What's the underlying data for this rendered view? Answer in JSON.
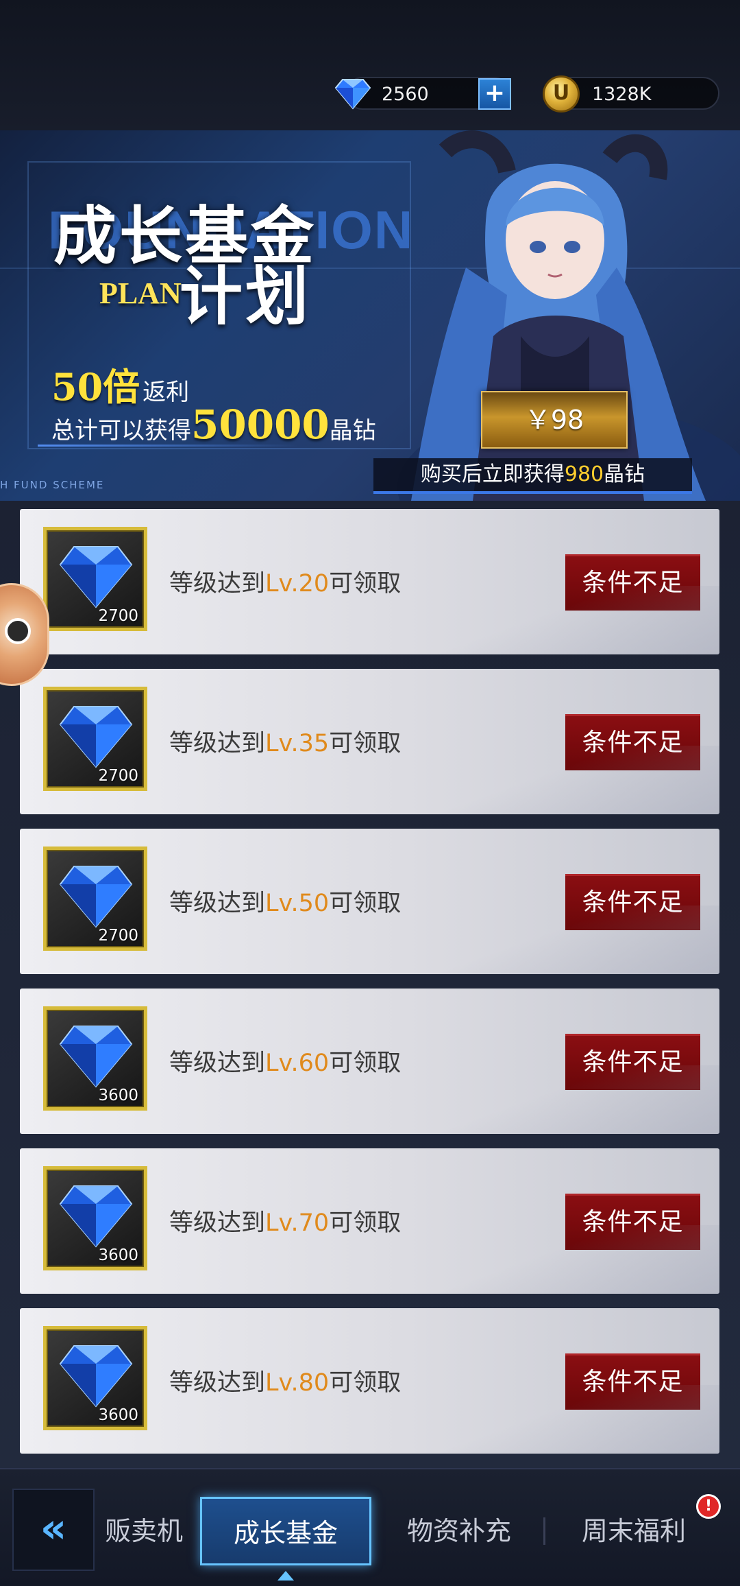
{
  "currency": {
    "diamonds": "2560",
    "coins": "1328K",
    "add_label": "+",
    "coin_symbol": "U"
  },
  "banner": {
    "title_main": "成长基金",
    "title_plan": "PLAN",
    "title_sub": "计划",
    "watermark": "FOUNDATION",
    "rebate_multiplier": "50倍",
    "rebate_word": "返利",
    "total_prefix": "总计可以获得",
    "total_amount": "50000",
    "total_suffix": "晶钻",
    "scheme_text": "H FUND SCHEME",
    "price": "￥98",
    "buy_note_prefix": "购买后立即获得",
    "buy_note_amount": "980",
    "buy_note_suffix": "晶钻"
  },
  "rewards": [
    {
      "amount": "2700",
      "text_prefix": "等级达到",
      "level": "Lv.20",
      "text_suffix": "可领取",
      "button": "条件不足"
    },
    {
      "amount": "2700",
      "text_prefix": "等级达到",
      "level": "Lv.35",
      "text_suffix": "可领取",
      "button": "条件不足"
    },
    {
      "amount": "2700",
      "text_prefix": "等级达到",
      "level": "Lv.50",
      "text_suffix": "可领取",
      "button": "条件不足"
    },
    {
      "amount": "3600",
      "text_prefix": "等级达到",
      "level": "Lv.60",
      "text_suffix": "可领取",
      "button": "条件不足"
    },
    {
      "amount": "3600",
      "text_prefix": "等级达到",
      "level": "Lv.70",
      "text_suffix": "可领取",
      "button": "条件不足"
    },
    {
      "amount": "3600",
      "text_prefix": "等级达到",
      "level": "Lv.80",
      "text_suffix": "可领取",
      "button": "条件不足"
    }
  ],
  "tabs": {
    "back": "«",
    "vending": "贩卖机",
    "fund": "成长基金",
    "supply": "物资补充",
    "weekend": "周末福利",
    "weekend_badge": "!"
  },
  "colors": {
    "accent_gold": "#ffe23c",
    "level_orange": "#e08a1c",
    "button_red": "#7a0a0d",
    "tab_active_border": "#66c4ff"
  },
  "icons": [
    "diamond-icon",
    "coin-icon",
    "plus-icon",
    "back-chevrons-icon",
    "alert-icon"
  ]
}
